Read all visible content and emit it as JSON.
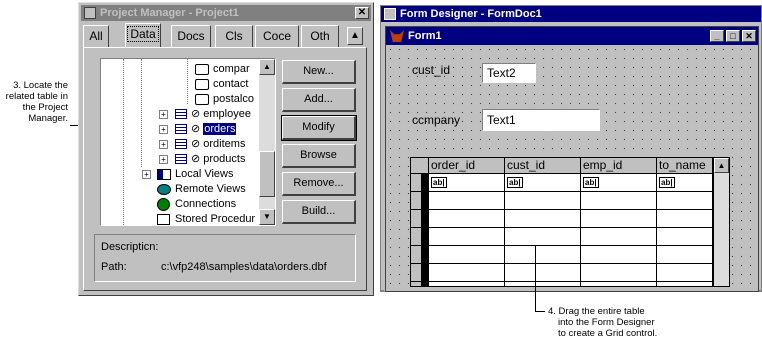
{
  "callout_left": {
    "lines": [
      "3. Locate the",
      "related table in",
      "the Project",
      "Manager."
    ]
  },
  "callout_bottom": {
    "lines": [
      "4. Drag the entire table",
      "into the Form Designer",
      "to create a Grid control."
    ]
  },
  "project_manager": {
    "title": "Project Manager - Project1",
    "tabs": [
      "All",
      "Data",
      "Docs",
      "Cls",
      "Coce",
      "Oth"
    ],
    "active_tab": "Data",
    "tree": [
      {
        "label": "compar",
        "icon": "dbf-icon"
      },
      {
        "label": "contact",
        "icon": "dbf-icon"
      },
      {
        "label": "postalco",
        "icon": "dbf-icon"
      },
      {
        "label": "employee",
        "icon": "table-icon",
        "prefix": "⊘"
      },
      {
        "label": "orders",
        "icon": "table-icon",
        "prefix": "⊘",
        "selected": true
      },
      {
        "label": "orditems",
        "icon": "table-icon",
        "prefix": "⊘"
      },
      {
        "label": "products",
        "icon": "table-icon",
        "prefix": "⊘"
      },
      {
        "label": "Local Views",
        "icon": "view-icon"
      },
      {
        "label": "Remote Views",
        "icon": "remote-view-icon"
      },
      {
        "label": "Connections",
        "icon": "connection-icon"
      },
      {
        "label": "Stored Procedur",
        "icon": "proc-icon"
      }
    ],
    "buttons": [
      "New...",
      "Add...",
      "Modify",
      "Browse",
      "Remove...",
      "Build..."
    ],
    "description_label": "Descripticn:",
    "path_label": "Path:",
    "path_value": "c:\\vfp248\\samples\\data\\orders.dbf"
  },
  "form_designer": {
    "title": "Form Designer - FormDoc1",
    "form_title": "Form1",
    "label1": "cust_id",
    "text1": "Text2",
    "label2": "ccmpany",
    "text2": "Text1",
    "grid_columns": [
      "order_id",
      "cust_id",
      "emp_id",
      "to_name"
    ],
    "cell_glyph": "ab|"
  },
  "colors": {
    "active_title": "#000080",
    "inactive_title": "#808080",
    "face": "#c0c0c0",
    "selection": "#000080"
  }
}
